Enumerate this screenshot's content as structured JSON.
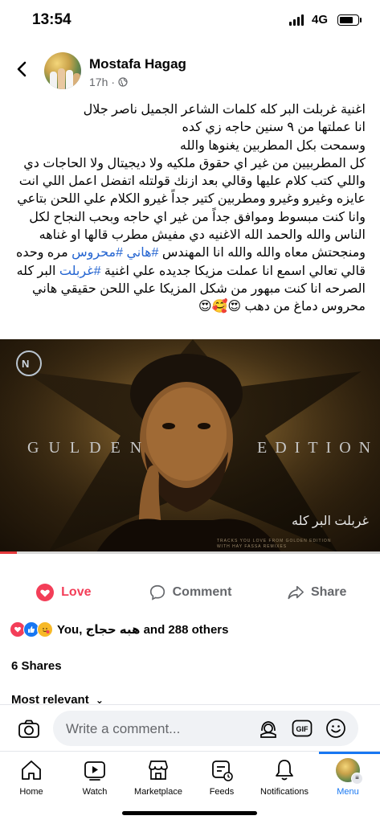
{
  "status_bar": {
    "time": "13:54",
    "network": "4G"
  },
  "post": {
    "author": "Mostafa Hagag",
    "time": "17h",
    "lines": [
      {
        "text": "اغنية غربلت البر كله كلمات الشاعر الجميل ناصر جلال"
      },
      {
        "text": "انا عملتها من ٩ سنين حاجه زي كده"
      },
      {
        "text": "وسمحت بكل المطربين يغنوها والله"
      },
      {
        "text": "كل المطربيين من غير اي حقوق ملكيه ولا ديجيتال ولا الحاجات دي"
      },
      {
        "text": "واللي كتب كلام عليها وقالي بعد ازنك قولتله اتفضل اعمل اللي انت"
      },
      {
        "text": "عايزه وغيرو وغيرو ومطربين كتير جداً غيرو الكلام علي اللحن بتاعي"
      },
      {
        "text": "وانا كنت مبسوط وموافق جداً من غير اي حاجه وبحب النجاح لكل"
      },
      {
        "text": "الناس والله  والحمد الله الاغنيه دي مفيش مطرب قالها او غناهه"
      },
      {
        "text": "ومنجحتش معاه  والله والله انا المهندس ",
        "tag1": "#هاني",
        "mid": " ",
        "tag2": "#محروس",
        "after": " مره وحده"
      },
      {
        "text": "قالي تعالي اسمع انا عملت مزيكا جديده علي اغنية ",
        "tag1": "#غربلت",
        "after": " البر كله"
      },
      {
        "text": "الصرحه انا كنت مبهور من شكل المزيكا علي اللحن حقيقي هاني"
      },
      {
        "text": "محروس دماغ من دهب ",
        "emoji": "😍🥰😍"
      }
    ],
    "image": {
      "edition_left": "GULDEN",
      "edition_right": "EDITION",
      "song_title": "غربلت البر كله",
      "small_caption_1": "TRACKS YOU LOVE FROM GOLDEN EDITION",
      "small_caption_2": "WITH HAY FASSA REMIXES"
    },
    "video_progress": 0.045
  },
  "actions": {
    "love": "Love",
    "comment": "Comment",
    "share": "Share"
  },
  "reactions": {
    "summary": "You, هبه حجاج and 288 others"
  },
  "shares": "6 Shares",
  "sort": "Most relevant",
  "comment_box": {
    "placeholder": "Write a comment..."
  },
  "tabs": [
    {
      "label": "Home"
    },
    {
      "label": "Watch"
    },
    {
      "label": "Marketplace"
    },
    {
      "label": "Feeds"
    },
    {
      "label": "Notifications"
    },
    {
      "label": "Menu"
    }
  ],
  "colors": {
    "accent": "#1877f2",
    "love": "#f33e58",
    "hashtag": "#2565d1",
    "secondary_text": "#65676b"
  }
}
